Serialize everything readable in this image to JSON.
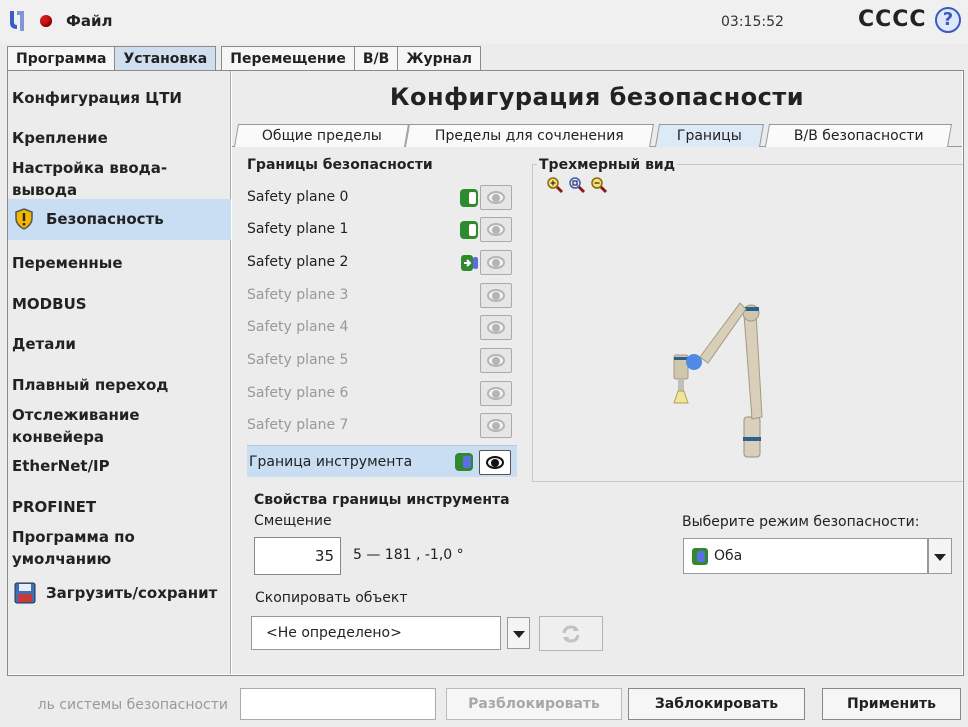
{
  "header": {
    "file_menu": "Файл",
    "clock": "03:15:52",
    "robot_name": "CCCC",
    "help_glyph": "?"
  },
  "main_tabs": [
    {
      "label": "Программа",
      "active": false
    },
    {
      "label": "Установка",
      "active": true
    },
    {
      "label": "Перемещение",
      "active": false
    },
    {
      "label": "В/В",
      "active": false
    },
    {
      "label": "Журнал",
      "active": false
    }
  ],
  "sidebar": {
    "items": [
      {
        "label": "Конфигурация ЦТИ"
      },
      {
        "label": "Крепление"
      },
      {
        "label": "Настройка ввода-вывода"
      },
      {
        "label": "Безопасность",
        "selected": true,
        "icon": "shield-warning-icon"
      },
      {
        "label": "Переменные"
      },
      {
        "label": "MODBUS"
      },
      {
        "label": "Детали"
      },
      {
        "label": "Плавный переход"
      },
      {
        "label": "Отслеживание конвейера"
      },
      {
        "label": "EtherNet/IP"
      },
      {
        "label": "PROFINET"
      },
      {
        "label": "Программа по умолчанию"
      },
      {
        "label": "Загрузить/сохранит",
        "icon": "floppy-disk-icon"
      }
    ]
  },
  "content": {
    "title": "Конфигурация безопасности",
    "sub_tabs": [
      {
        "label": "Общие пределы",
        "active": false
      },
      {
        "label": "Пределы для сочленения",
        "active": false
      },
      {
        "label": "Границы",
        "active": true
      },
      {
        "label": "В/В безопасности",
        "active": false
      }
    ],
    "boundaries_header": "Границы безопасности",
    "planes": [
      {
        "label": "Safety plane 0",
        "enabled": true,
        "mode": "normal"
      },
      {
        "label": "Safety plane 1",
        "enabled": true,
        "mode": "normal"
      },
      {
        "label": "Safety plane 2",
        "enabled": true,
        "mode": "trigger"
      },
      {
        "label": "Safety plane 3",
        "enabled": false
      },
      {
        "label": "Safety plane 4",
        "enabled": false
      },
      {
        "label": "Safety plane 5",
        "enabled": false
      },
      {
        "label": "Safety plane 6",
        "enabled": false
      },
      {
        "label": "Safety plane 7",
        "enabled": false
      }
    ],
    "tool_boundary": {
      "label": "Граница инструмента",
      "enabled": true,
      "visible": true
    },
    "view3d_label": "Трехмерный вид",
    "zoom_icons": [
      "zoom-in-icon",
      "zoom-fit-icon",
      "zoom-out-icon"
    ],
    "tool_props_header": "Свойства границы инструмента",
    "offset_label": "Смещение",
    "offset_value": "35",
    "offset_range": "5 — 181 , -1,0 °",
    "copy_label": "Скопировать объект",
    "copy_value": "<Не определено>",
    "safety_mode_label": "Выберите режим безопасности:",
    "safety_mode_value": "Оба"
  },
  "bottom": {
    "password_label": "ль системы безопасности",
    "unlock_button": "Разблокировать",
    "lock_button": "Заблокировать",
    "apply_button": "Применить"
  },
  "colors": {
    "selection_blue": "#c9ddf3",
    "toggle_green": "#2f8a2f",
    "mode_blue": "#5b6ee6",
    "alert_red": "#d01818",
    "help_blue": "#3a5bbd"
  }
}
